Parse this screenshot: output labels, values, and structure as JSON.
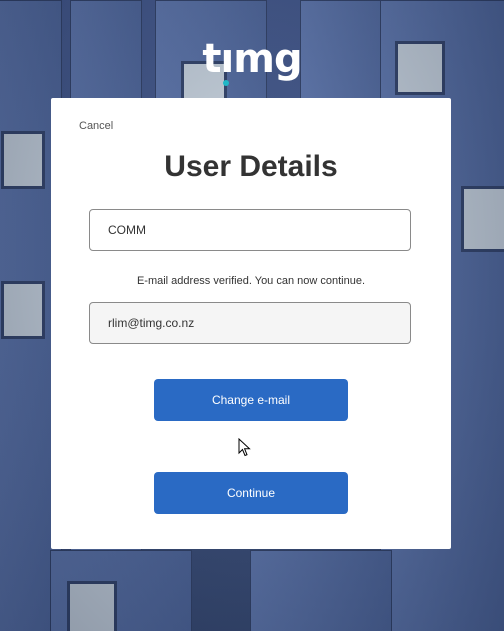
{
  "logo": {
    "text_before": "t",
    "text_i": "ı",
    "text_after": "mg"
  },
  "form": {
    "cancel_label": "Cancel",
    "title": "User Details",
    "company_value": "COMM",
    "verified_message": "E-mail address verified. You can now continue.",
    "email_value": "rlim@timg.co.nz",
    "change_email_label": "Change e-mail",
    "continue_label": "Continue"
  },
  "colors": {
    "accent_button": "#2a6ac4",
    "logo_dot": "#1fb7c6",
    "background": "#3d5283"
  }
}
